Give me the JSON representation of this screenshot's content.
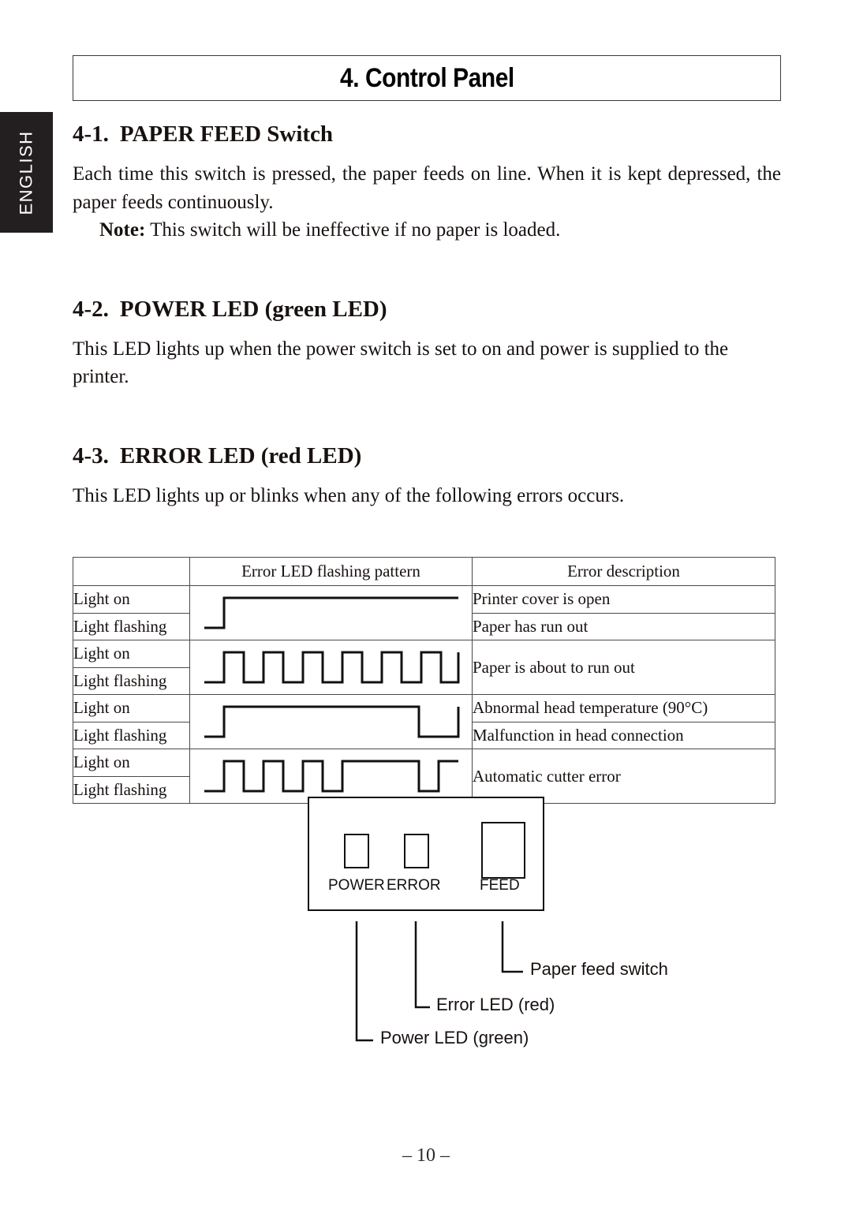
{
  "language_tab": {
    "label": "ENGLISH"
  },
  "chapter": {
    "title": "4. Control Panel"
  },
  "sections": [
    {
      "number": "4-1.",
      "title": "PAPER FEED Switch",
      "body": "Each time this switch is pressed, the paper feeds on line. When it is kept depressed, the paper feeds continuously.",
      "note_label": "Note:",
      "note_text": "This switch will be ineffective if no paper is loaded."
    },
    {
      "number": "4-2.",
      "title": "POWER LED (green LED)",
      "body": "This LED lights up when the power switch is set to on and power is supplied to the printer."
    },
    {
      "number": "4-3.",
      "title": "ERROR LED (red LED)",
      "body": "This LED lights up or blinks when any of the following errors occurs."
    }
  ],
  "error_table": {
    "headers": [
      "",
      "Error LED flashing pattern",
      "Error description"
    ],
    "state_labels": {
      "on": "Light on",
      "flashing": "Light flashing"
    },
    "rows": [
      {
        "pattern_name": "cover-open-pattern",
        "descriptions": [
          "Printer cover is open",
          "Paper has run out"
        ],
        "merged_description": false
      },
      {
        "pattern_name": "paper-near-end-pattern",
        "descriptions": [
          "Paper is about to run out"
        ],
        "merged_description": true
      },
      {
        "pattern_name": "head-temperature-pattern",
        "descriptions": [
          "Abnormal head temperature (90°C)",
          "Malfunction in head connection"
        ],
        "merged_description": false
      },
      {
        "pattern_name": "cutter-error-pattern",
        "descriptions": [
          "Automatic cutter error"
        ],
        "merged_description": true
      }
    ]
  },
  "control_panel": {
    "power_label": "POWER",
    "error_label": "ERROR",
    "feed_label": "FEED",
    "callouts": [
      {
        "name": "paper-feed-switch",
        "text": "Paper feed switch"
      },
      {
        "name": "error-led",
        "text": "Error LED (red)"
      },
      {
        "name": "power-led",
        "text": "Power LED (green)"
      }
    ]
  },
  "footer": {
    "page_number": "– 10 –"
  }
}
